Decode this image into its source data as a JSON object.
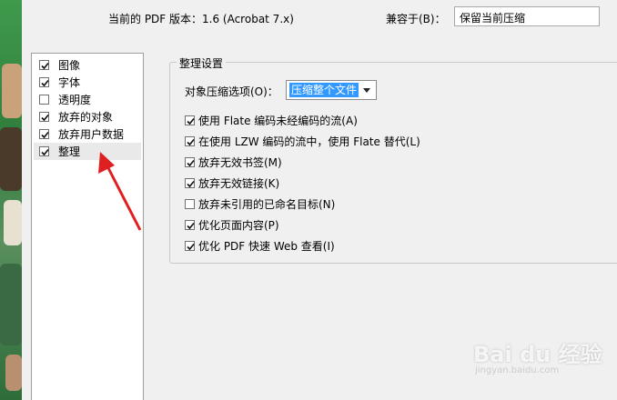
{
  "header": {
    "version_text": "当前的 PDF 版本：1.6 (Acrobat 7.x)",
    "compat_label": "兼容于(B)：",
    "compat_value": "保留当前压缩"
  },
  "sidebar": {
    "items": [
      {
        "label": "图像",
        "checked": true
      },
      {
        "label": "字体",
        "checked": true
      },
      {
        "label": "透明度",
        "checked": false
      },
      {
        "label": "放弃的对象",
        "checked": true
      },
      {
        "label": "放弃用户数据",
        "checked": true
      },
      {
        "label": "整理",
        "checked": true,
        "selected": true
      }
    ]
  },
  "panel": {
    "title": "整理设置",
    "object_compression_label": "对象压缩选项(O)：",
    "object_compression_value": "压缩整个文件",
    "options": [
      {
        "label": "使用 Flate 编码未经编码的流(A)",
        "checked": true
      },
      {
        "label": "在使用 LZW 编码的流中，使用 Flate 替代(L)",
        "checked": true
      },
      {
        "label": "放弃无效书签(M)",
        "checked": true
      },
      {
        "label": "放弃无效链接(K)",
        "checked": true
      },
      {
        "label": "放弃未引用的已命名目标(N)",
        "checked": false
      },
      {
        "label": "优化页面内容(P)",
        "checked": true
      },
      {
        "label": "优化 PDF 快速 Web 查看(I)",
        "checked": true
      }
    ]
  },
  "watermark": {
    "main": "Bai du 经验",
    "sub": "jingyan.baidu.com"
  },
  "colors": {
    "annotation_arrow": "#e02020",
    "selection_highlight": "#3399ff",
    "side_image_green": "#3f9a4c"
  }
}
